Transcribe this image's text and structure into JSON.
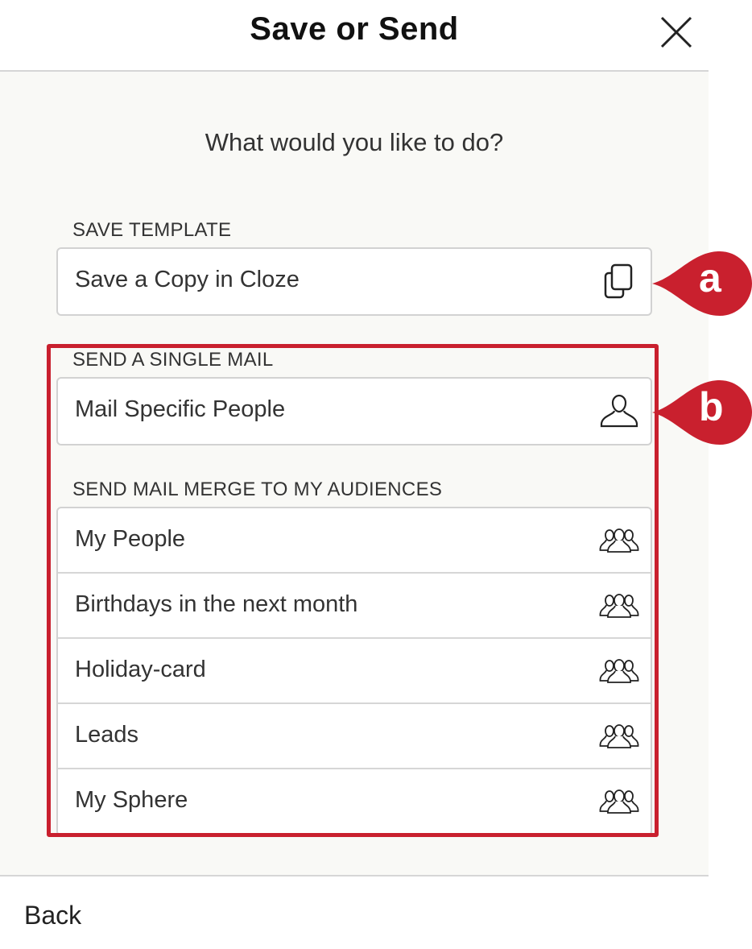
{
  "dialog": {
    "title": "Save or Send",
    "close_icon": "close-icon"
  },
  "content": {
    "question": "What would you like to do?",
    "save_template": {
      "label": "Save Template",
      "items": [
        {
          "label": "Save a Copy in Cloze",
          "icon": "copy-icon"
        }
      ]
    },
    "single_mail": {
      "label": "Send a Single Mail",
      "items": [
        {
          "label": "Mail Specific People",
          "icon": "person-icon"
        }
      ]
    },
    "mail_merge": {
      "label": "Send Mail Merge to My Audiences",
      "items": [
        {
          "label": "My People",
          "icon": "group-icon"
        },
        {
          "label": "Birthdays in the next month",
          "icon": "group-icon"
        },
        {
          "label": "Holiday-card",
          "icon": "group-icon"
        },
        {
          "label": "Leads",
          "icon": "group-icon"
        },
        {
          "label": "My Sphere",
          "icon": "group-icon"
        }
      ]
    }
  },
  "annotations": {
    "a": "a",
    "b": "b",
    "color": "#c9202e"
  },
  "footer": {
    "back_label": "Back"
  }
}
